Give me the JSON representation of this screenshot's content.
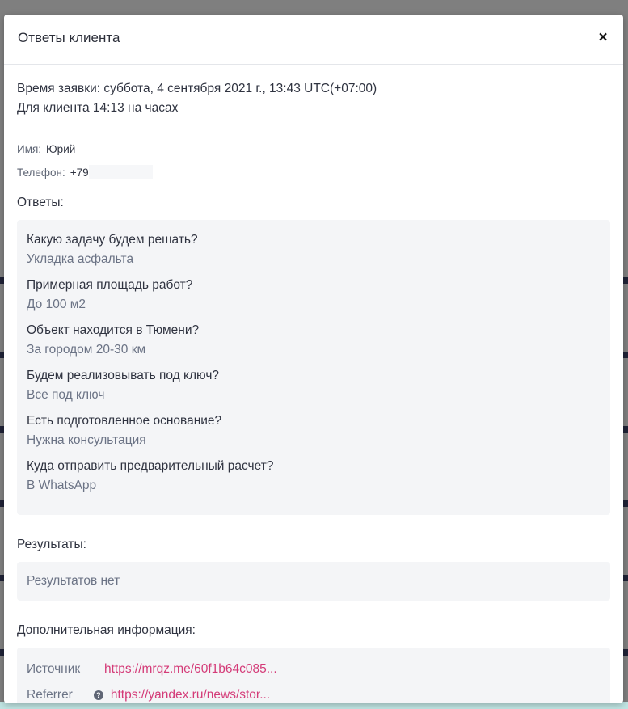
{
  "modal": {
    "title": "Ответы клиента",
    "close_glyph": "×"
  },
  "request": {
    "time_line": "Время заявки: суббота, 4 сентября 2021 г., 13:43 UTC(+07:00)",
    "client_time_line": "Для клиента 14:13 на часах"
  },
  "contact": {
    "name_label": "Имя:",
    "name_value": "Юрий",
    "phone_label": "Телефон:",
    "phone_value": "+79"
  },
  "answers": {
    "title": "Ответы:",
    "items": [
      {
        "question": "Какую задачу будем решать?",
        "answer": "Укладка асфальта"
      },
      {
        "question": "Примерная площадь работ?",
        "answer": "До 100 м2"
      },
      {
        "question": "Объект находится в Тюмени?",
        "answer": "За городом 20-30 км"
      },
      {
        "question": "Будем реализовывать под ключ?",
        "answer": "Все под ключ"
      },
      {
        "question": "Есть подготовленное основание?",
        "answer": "Нужна консультация"
      },
      {
        "question": "Куда отправить предварительный расчет?",
        "answer": "В WhatsApp"
      }
    ]
  },
  "results": {
    "title": "Результаты:",
    "empty_text": "Результатов нет"
  },
  "extra": {
    "title": "Дополнительная информация:",
    "source_label": "Источник",
    "source_link": "https://mrqz.me/60f1b64c085...",
    "referrer_label": "Referrer",
    "referrer_help_icon": "help-circle-icon",
    "referrer_link": "https://yandex.ru/news/stor..."
  },
  "colors": {
    "link": "#d43b78",
    "panel_bg": "#f4f5f7",
    "bottom_bar": "#bfe4e2"
  }
}
